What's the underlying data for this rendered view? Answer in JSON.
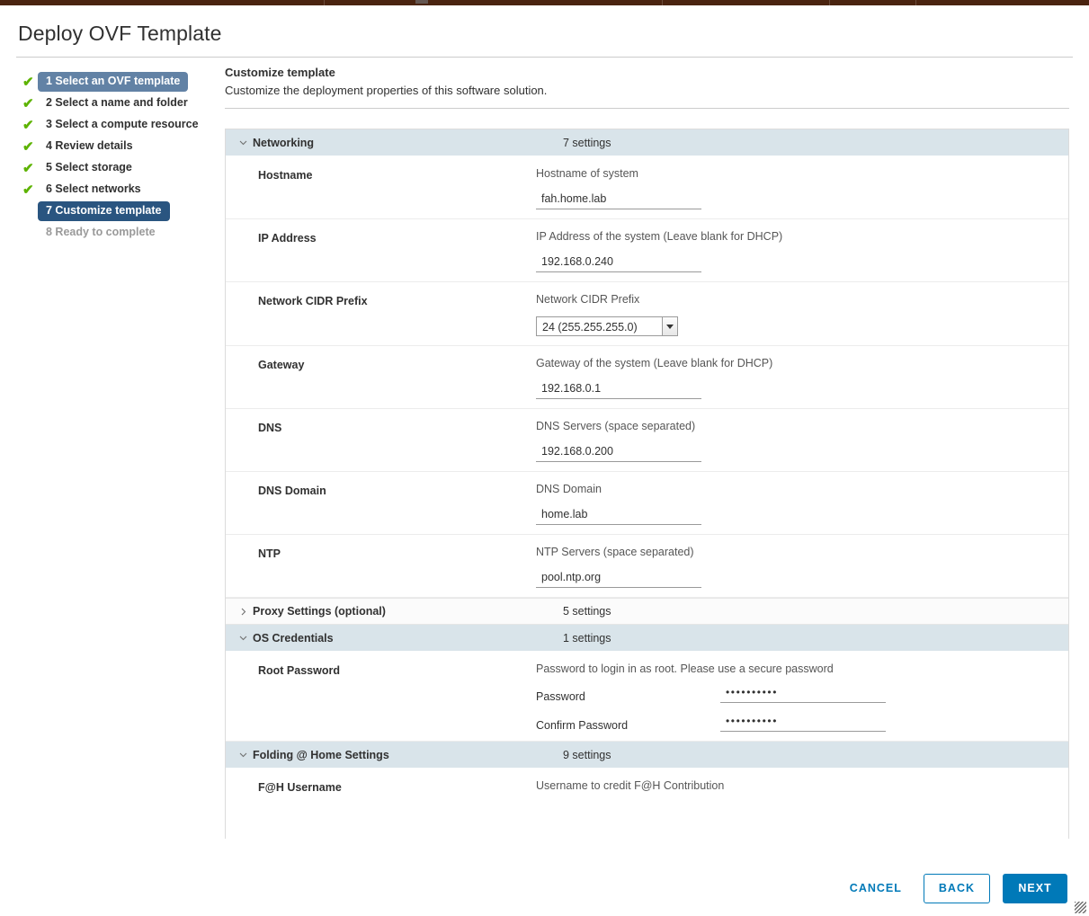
{
  "window": {
    "title": "Deploy OVF Template",
    "tabstrip_color": "#4a2410"
  },
  "colors": {
    "accent": "#0079b8",
    "step_current": "#2a5580",
    "step_first": "#6282a5",
    "check_green": "#5db300",
    "section_header_bg": "#d9e4ea"
  },
  "sidebar": {
    "items": [
      {
        "label": "1 Select an OVF template",
        "state": "visited-first",
        "check": "✔"
      },
      {
        "label": "2 Select a name and folder",
        "state": "done",
        "check": "✔"
      },
      {
        "label": "3 Select a compute resource",
        "state": "done",
        "check": "✔"
      },
      {
        "label": "4 Review details",
        "state": "done",
        "check": "✔"
      },
      {
        "label": "5 Select storage",
        "state": "done",
        "check": "✔"
      },
      {
        "label": "6 Select networks",
        "state": "done",
        "check": "✔"
      },
      {
        "label": "7 Customize template",
        "state": "current",
        "check": ""
      },
      {
        "label": "8 Ready to complete",
        "state": "pending",
        "check": ""
      }
    ]
  },
  "content": {
    "title": "Customize template",
    "subtitle": "Customize the deployment properties of this software solution."
  },
  "sections": [
    {
      "name": "Networking",
      "count_label": "7 settings",
      "expanded": true,
      "chevron": "chevron-down-icon",
      "rows": [
        {
          "label": "Hostname",
          "description": "Hostname of system",
          "control": "text",
          "value": "fah.home.lab"
        },
        {
          "label": "IP Address",
          "description": "IP Address of the system (Leave blank for DHCP)",
          "control": "text",
          "value": "192.168.0.240"
        },
        {
          "label": "Network CIDR Prefix",
          "description": "Network CIDR Prefix",
          "control": "select",
          "value": "24 (255.255.255.0)"
        },
        {
          "label": "Gateway",
          "description": "Gateway of the system (Leave blank for DHCP)",
          "control": "text",
          "value": "192.168.0.1"
        },
        {
          "label": "DNS",
          "description": "DNS Servers (space separated)",
          "control": "text",
          "value": "192.168.0.200"
        },
        {
          "label": "DNS Domain",
          "description": "DNS Domain",
          "control": "text",
          "value": "home.lab"
        },
        {
          "label": "NTP",
          "description": "NTP Servers (space separated)",
          "control": "text",
          "value": "pool.ntp.org"
        }
      ]
    },
    {
      "name": "Proxy Settings (optional)",
      "count_label": "5 settings",
      "expanded": false,
      "chevron": "chevron-right-icon",
      "rows": []
    },
    {
      "name": "OS Credentials",
      "count_label": "1 settings",
      "expanded": true,
      "chevron": "chevron-down-icon",
      "rows": [
        {
          "label": "Root Password",
          "description": "Password to login in as root. Please use a secure password",
          "control": "password-pair",
          "password_label": "Password",
          "password_value": "••••••••••",
          "confirm_label": "Confirm Password",
          "confirm_value": "••••••••••"
        }
      ]
    },
    {
      "name": "Folding @ Home Settings",
      "count_label": "9 settings",
      "expanded": true,
      "chevron": "chevron-down-icon",
      "rows": [
        {
          "label": "F@H Username",
          "description": "Username to credit F@H Contribution",
          "control": "none",
          "value": ""
        }
      ]
    }
  ],
  "footer": {
    "cancel_label": "CANCEL",
    "back_label": "BACK",
    "next_label": "NEXT"
  }
}
